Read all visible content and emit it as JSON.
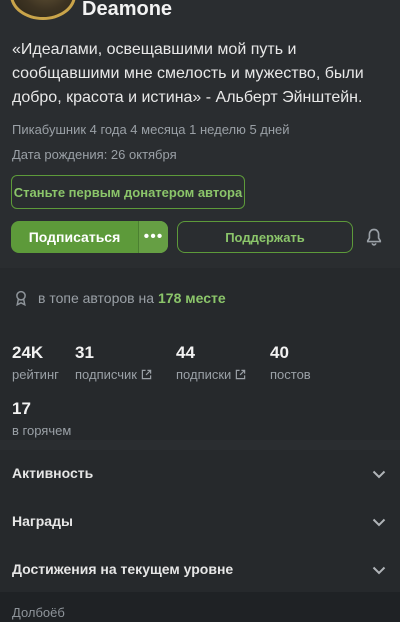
{
  "profile": {
    "username": "Deamone",
    "quote": "«Идеалами, освещавшими мой путь и сообщавшими мне смелость и мужество, были добро, красота и истина» - Альберт Эйнштейн.",
    "tenure": "Пикабушник 4 года 4 месяца 1 неделю 5 дней",
    "birthday": "Дата рождения: 26 октября",
    "donor_button": "Станьте первым донатером автора",
    "subscribe_button": "Подписаться",
    "more_button": "•••",
    "support_button": "Поддержать"
  },
  "rank": {
    "prefix": "в топе авторов на",
    "place": "178 месте"
  },
  "stats": [
    {
      "value": "24K",
      "label": "рейтинг"
    },
    {
      "value": "31",
      "label": "подписчик"
    },
    {
      "value": "44",
      "label": "подписки"
    },
    {
      "value": "40",
      "label": "постов"
    },
    {
      "value": "17",
      "label": "в горячем"
    }
  ],
  "sections": [
    {
      "title": "Активность"
    },
    {
      "title": "Награды"
    },
    {
      "title": "Достижения на текущем уровне"
    }
  ],
  "bottom_label": "Долбоёб",
  "colors": {
    "accent": "#5d9a3a",
    "accent_text": "#8bc56a",
    "background": "#2a2d30"
  }
}
